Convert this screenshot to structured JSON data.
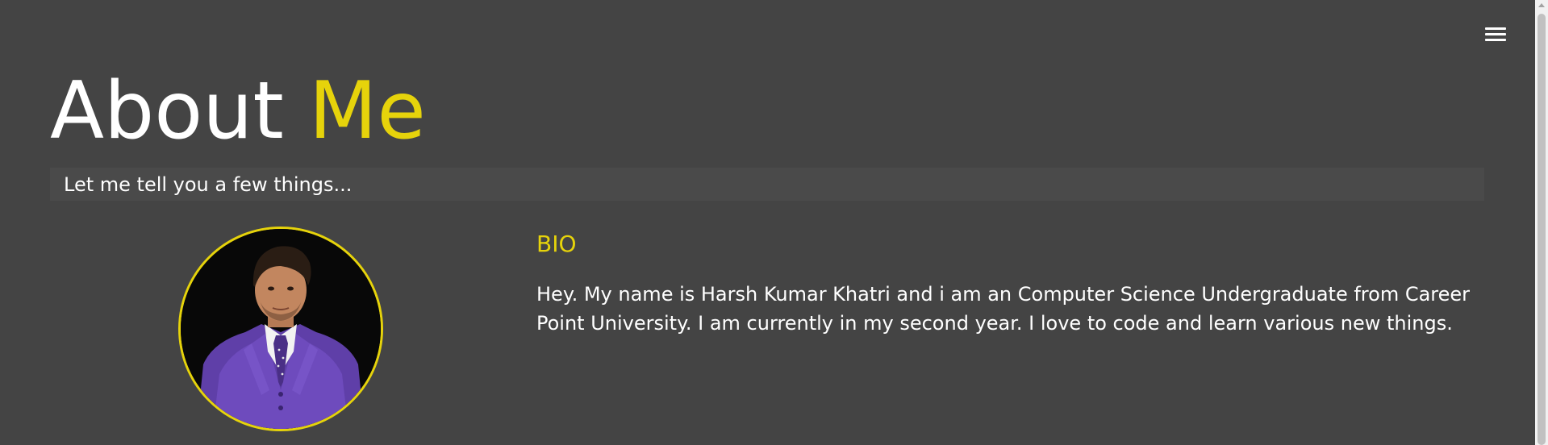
{
  "header": {
    "menu_icon": "hamburger-menu-icon"
  },
  "about": {
    "title_main": "About ",
    "title_accent": "Me",
    "subtitle": "Let me tell you a few things..."
  },
  "bio": {
    "heading": "BIO",
    "text": "Hey. My name is Harsh Kumar Khatri and i am an Computer Science Undergraduate from Career Point University. I am currently in my second year. I love to code and learn various new things."
  },
  "colors": {
    "background": "#444444",
    "accent": "#e6d30b",
    "text": "#ffffff"
  }
}
